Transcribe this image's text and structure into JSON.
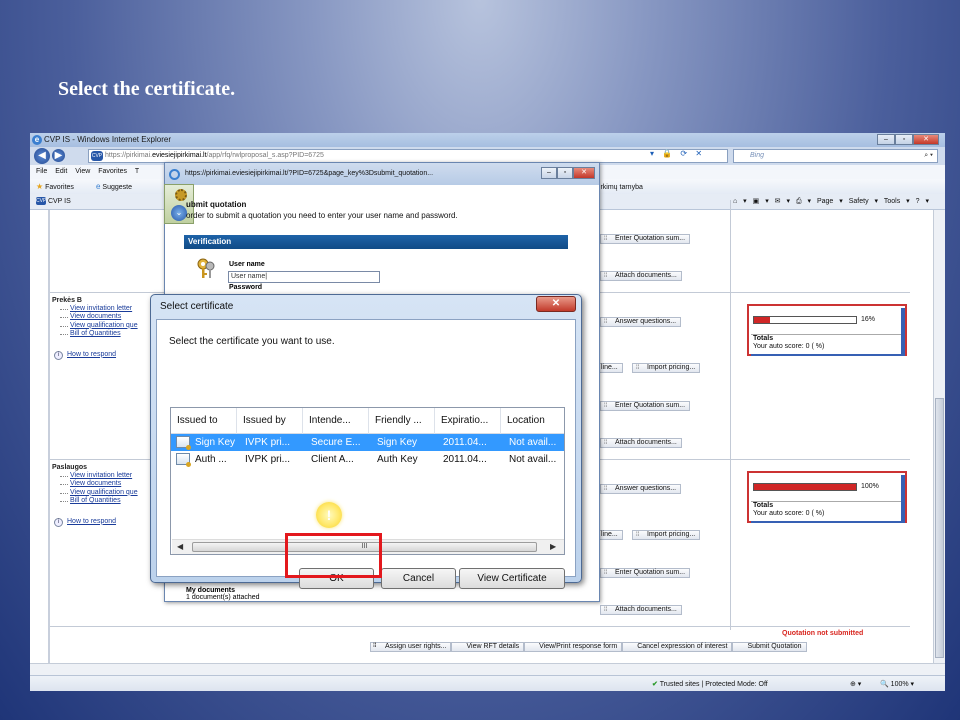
{
  "slide": {
    "title": "Select the certificate."
  },
  "ie": {
    "window_title": "CVP IS - Windows Internet Explorer",
    "address_prefix": "https://pirkimai.",
    "address_domain": "eviesiejipirkimai.lt",
    "address_path": "/app/rfq/rwlproposal_s.asp?PID=6725",
    "search_placeholder": "Bing",
    "menu": [
      "File",
      "Edit",
      "View",
      "Favorites",
      "T"
    ],
    "favorites_label": "Favorites",
    "suggested_label": "Suggeste",
    "tab_label": "CVP IS",
    "page_header_tail": "pirkimų tarnyba",
    "command_bar": [
      "Page ▾",
      "Safety ▾",
      "Tools ▾"
    ],
    "status_trusted": "Trusted sites | Protected Mode: Off",
    "zoom": "100%"
  },
  "sections": [
    {
      "title": "Prekės B",
      "links": [
        "View invitation letter",
        "View documents",
        "View qualification que",
        "Bill of Quantities"
      ],
      "how_to_respond": "How to respond",
      "score_percent": 16,
      "score_label": "16%",
      "totals_label": "Totals",
      "auto_score": "Your auto score: 0 (  %)"
    },
    {
      "title": "Paslaugos",
      "links": [
        "View invitation letter",
        "View documents",
        "View qualification que",
        "Bill of Quantities"
      ],
      "how_to_respond": "How to respond",
      "score_percent": 100,
      "score_label": "100%",
      "totals_label": "Totals",
      "auto_score": "Your auto score: 0 (  %)"
    }
  ],
  "page_buttons": {
    "enter_quotation": "Enter Quotation sum...",
    "attach_documents": "Attach documents...",
    "answer_questions": "Answer questions...",
    "import_pricing": "Import pricing...",
    "line_partial": "line..."
  },
  "not_submitted": "Quotation not submitted",
  "bottom_actions": [
    "Assign user rights...",
    "View RFT details",
    "View/Print response form",
    "Cancel expression of interest",
    "Submit Quotation"
  ],
  "popup": {
    "title": "https://pirkimai.eviesiejipirkimai.lt/?PID=6725&page_key%3Dsubmit_quotation...",
    "heading": "ubmit quotation",
    "instruction": "order to submit a quotation you need to enter your user name and password.",
    "verification": "Verification",
    "user_name_label": "User name",
    "user_name_value": "User name",
    "password_label": "Password",
    "my_documents": "My documents",
    "docs_attached": "1 document(s) attached"
  },
  "dialog": {
    "title": "Select certificate",
    "prompt": "Select the certificate you want to use.",
    "columns": [
      "Issued to",
      "Issued by",
      "Intende...",
      "Friendly ...",
      "Expiratio...",
      "Location"
    ],
    "rows": [
      [
        "Sign Key",
        "IVPK pri...",
        "Secure E...",
        "Sign Key",
        "2011.04...",
        "Not avail..."
      ],
      [
        "Auth ...",
        "IVPK pri...",
        "Client A...",
        "Auth Key",
        "2011.04...",
        "Not avail..."
      ]
    ],
    "selected_row": 0,
    "scroll_thumb": "III",
    "ok": "OK",
    "cancel": "Cancel",
    "view_certificate": "View Certificate"
  },
  "marker_symbol": "!",
  "colors": {
    "highlight": "#e3181d",
    "selection": "#3399ff",
    "verification_bar": "#1e63a8",
    "not_submitted": "#d8261f"
  }
}
